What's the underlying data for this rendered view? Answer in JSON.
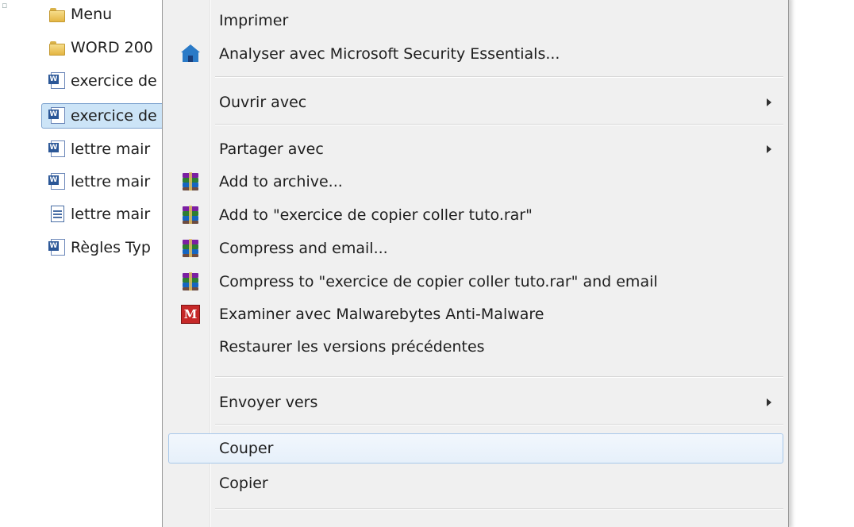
{
  "explorer": {
    "files": [
      {
        "name": "Menu",
        "type": "folder",
        "selected": false
      },
      {
        "name": "WORD 200",
        "type": "folder",
        "selected": false
      },
      {
        "name": "exercice de",
        "type": "word-doc",
        "selected": false
      },
      {
        "name": "exercice de",
        "type": "word-doc",
        "selected": true
      },
      {
        "name": "lettre mair",
        "type": "word-doc",
        "selected": false
      },
      {
        "name": "lettre mair",
        "type": "word-doc",
        "selected": false
      },
      {
        "name": "lettre mair",
        "type": "text-doc",
        "selected": false
      },
      {
        "name": "Règles Typ",
        "type": "word-doc",
        "selected": false
      }
    ]
  },
  "context_menu": {
    "items": [
      {
        "label": "Imprimer",
        "icon": null,
        "submenu": false
      },
      {
        "label": "Analyser avec Microsoft Security Essentials...",
        "icon": "microsoft-security-essentials-icon",
        "submenu": false
      },
      {
        "label": "Ouvrir avec",
        "icon": null,
        "submenu": true
      },
      {
        "label": "Partager avec",
        "icon": null,
        "submenu": true
      },
      {
        "label": "Add to archive...",
        "icon": "winrar-icon",
        "submenu": false
      },
      {
        "label": "Add to \"exercice de copier coller tuto.rar\"",
        "icon": "winrar-icon",
        "submenu": false
      },
      {
        "label": "Compress and email...",
        "icon": "winrar-icon",
        "submenu": false
      },
      {
        "label": "Compress to \"exercice de copier coller tuto.rar\" and email",
        "icon": "winrar-icon",
        "submenu": false
      },
      {
        "label": "Examiner avec Malwarebytes Anti-Malware",
        "icon": "malwarebytes-icon",
        "submenu": false
      },
      {
        "label": "Restaurer les versions précédentes",
        "icon": null,
        "submenu": false
      },
      {
        "label": "Envoyer vers",
        "icon": null,
        "submenu": true
      },
      {
        "label": "Couper",
        "icon": null,
        "submenu": false,
        "highlighted": true
      },
      {
        "label": "Copier",
        "icon": null,
        "submenu": false
      }
    ],
    "mbam_glyph": "M"
  },
  "colors": {
    "menu_background": "#f0f0f0",
    "hover_border": "#a8c8ea",
    "selection_background": "#cce4f7"
  }
}
